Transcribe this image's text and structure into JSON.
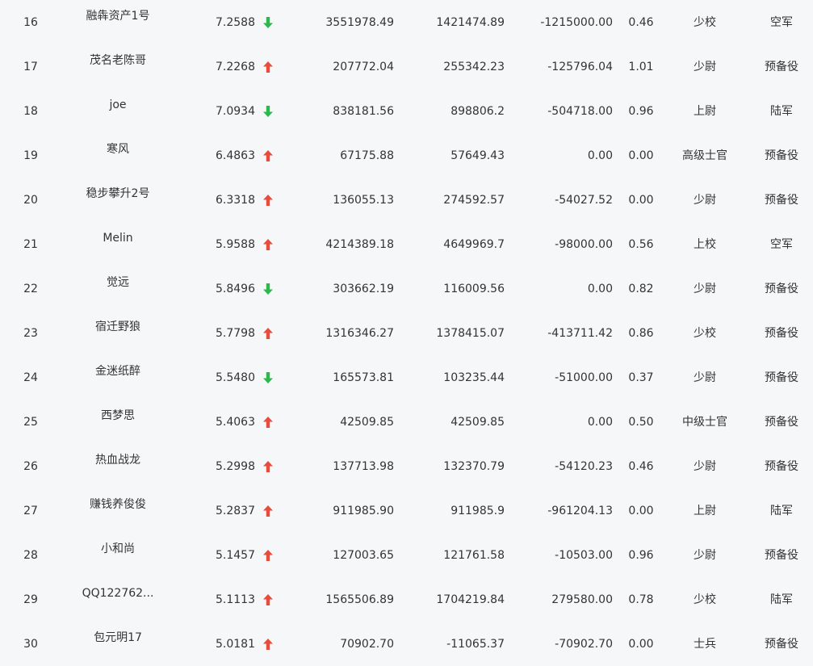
{
  "colors": {
    "background": "#f6f7f9",
    "text": "#333333",
    "arrow_up": "#e84c3d",
    "arrow_down": "#2db84d"
  },
  "rows": [
    {
      "rank": "16",
      "name": "融犇资产1号",
      "score": "7.2588",
      "trend": "down",
      "v1": "3551978.49",
      "v2": "1421474.89",
      "v3": "-1215000.00",
      "ratio": "0.46",
      "title": "少校",
      "branch": "空军"
    },
    {
      "rank": "17",
      "name": "茂名老陈哥",
      "score": "7.2268",
      "trend": "up",
      "v1": "207772.04",
      "v2": "255342.23",
      "v3": "-125796.04",
      "ratio": "1.01",
      "title": "少尉",
      "branch": "预备役"
    },
    {
      "rank": "18",
      "name": "joe",
      "score": "7.0934",
      "trend": "down",
      "v1": "838181.56",
      "v2": "898806.2",
      "v3": "-504718.00",
      "ratio": "0.96",
      "title": "上尉",
      "branch": "陆军"
    },
    {
      "rank": "19",
      "name": "寒风",
      "score": "6.4863",
      "trend": "up",
      "v1": "67175.88",
      "v2": "57649.43",
      "v3": "0.00",
      "ratio": "0.00",
      "title": "高级士官",
      "branch": "预备役"
    },
    {
      "rank": "20",
      "name": "稳步攀升2号",
      "score": "6.3318",
      "trend": "up",
      "v1": "136055.13",
      "v2": "274592.57",
      "v3": "-54027.52",
      "ratio": "0.00",
      "title": "少尉",
      "branch": "预备役"
    },
    {
      "rank": "21",
      "name": "Melin",
      "score": "5.9588",
      "trend": "up",
      "v1": "4214389.18",
      "v2": "4649969.7",
      "v3": "-98000.00",
      "ratio": "0.56",
      "title": "上校",
      "branch": "空军"
    },
    {
      "rank": "22",
      "name": "觉远",
      "score": "5.8496",
      "trend": "down",
      "v1": "303662.19",
      "v2": "116009.56",
      "v3": "0.00",
      "ratio": "0.82",
      "title": "少尉",
      "branch": "预备役"
    },
    {
      "rank": "23",
      "name": "宿迁野狼",
      "score": "5.7798",
      "trend": "up",
      "v1": "1316346.27",
      "v2": "1378415.07",
      "v3": "-413711.42",
      "ratio": "0.86",
      "title": "少校",
      "branch": "预备役"
    },
    {
      "rank": "24",
      "name": "金迷纸醉",
      "score": "5.5480",
      "trend": "down",
      "v1": "165573.81",
      "v2": "103235.44",
      "v3": "-51000.00",
      "ratio": "0.37",
      "title": "少尉",
      "branch": "预备役"
    },
    {
      "rank": "25",
      "name": "西梦思",
      "score": "5.4063",
      "trend": "up",
      "v1": "42509.85",
      "v2": "42509.85",
      "v3": "0.00",
      "ratio": "0.50",
      "title": "中级士官",
      "branch": "预备役"
    },
    {
      "rank": "26",
      "name": "热血战龙",
      "score": "5.2998",
      "trend": "up",
      "v1": "137713.98",
      "v2": "132370.79",
      "v3": "-54120.23",
      "ratio": "0.46",
      "title": "少尉",
      "branch": "预备役"
    },
    {
      "rank": "27",
      "name": "赚钱养俊俊",
      "score": "5.2837",
      "trend": "up",
      "v1": "911985.90",
      "v2": "911985.9",
      "v3": "-961204.13",
      "ratio": "0.00",
      "title": "上尉",
      "branch": "陆军"
    },
    {
      "rank": "28",
      "name": "小和尚",
      "score": "5.1457",
      "trend": "up",
      "v1": "127003.65",
      "v2": "121761.58",
      "v3": "-10503.00",
      "ratio": "0.96",
      "title": "少尉",
      "branch": "预备役"
    },
    {
      "rank": "29",
      "name": "QQ122762...",
      "score": "5.1113",
      "trend": "up",
      "v1": "1565506.89",
      "v2": "1704219.84",
      "v3": "279580.00",
      "ratio": "0.78",
      "title": "少校",
      "branch": "陆军"
    },
    {
      "rank": "30",
      "name": "包元明17",
      "score": "5.0181",
      "trend": "up",
      "v1": "70902.70",
      "v2": "-11065.37",
      "v3": "-70902.70",
      "ratio": "0.00",
      "title": "士兵",
      "branch": "预备役"
    }
  ]
}
